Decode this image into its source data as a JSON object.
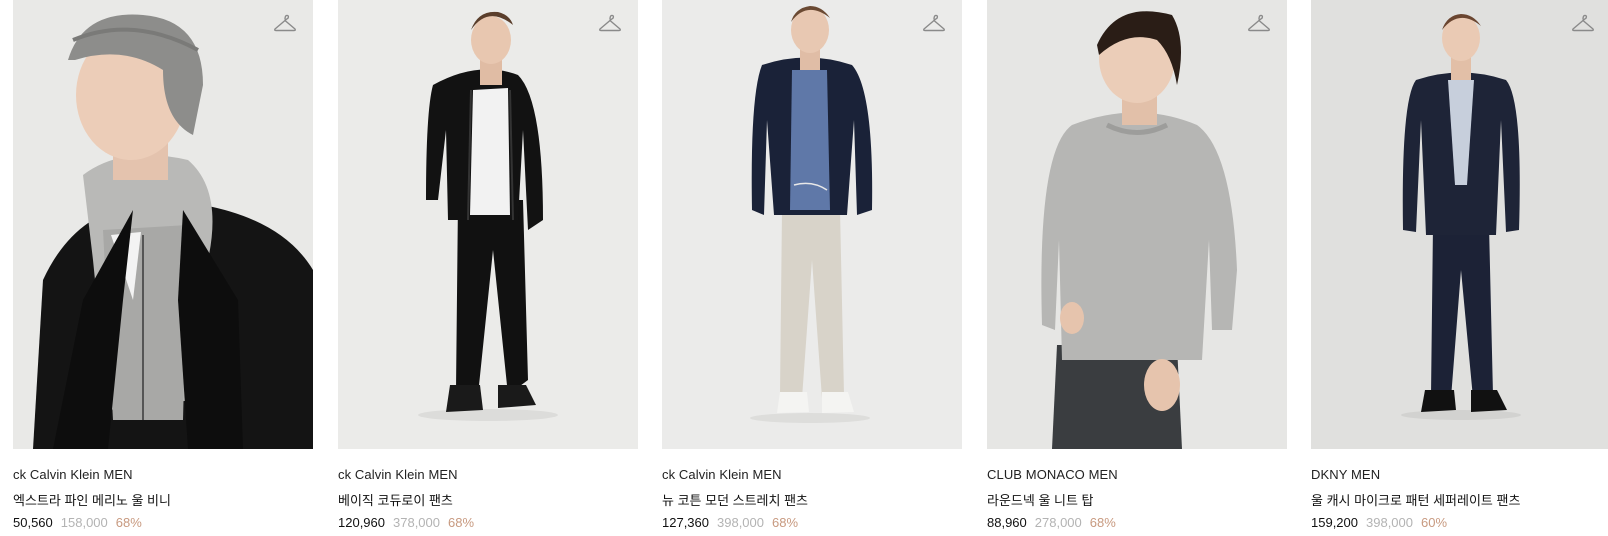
{
  "products": [
    {
      "brand": "ck Calvin Klein MEN",
      "name": "엑스트라 파인 메리노 울 비니",
      "sale_price": "50,560",
      "original_price": "158,000",
      "discount": "68%",
      "icon": "hanger-icon"
    },
    {
      "brand": "ck Calvin Klein MEN",
      "name": "베이직 코듀로이 팬츠",
      "sale_price": "120,960",
      "original_price": "378,000",
      "discount": "68%",
      "icon": "hanger-icon"
    },
    {
      "brand": "ck Calvin Klein MEN",
      "name": "뉴 코튼 모던 스트레치 팬츠",
      "sale_price": "127,360",
      "original_price": "398,000",
      "discount": "68%",
      "icon": "hanger-icon"
    },
    {
      "brand": "CLUB MONACO MEN",
      "name": "라운드넥 울 니트 탑",
      "sale_price": "88,960",
      "original_price": "278,000",
      "discount": "68%",
      "icon": "hanger-icon"
    },
    {
      "brand": "DKNY MEN",
      "name": "울 캐시 마이크로 패턴 세퍼레이트 팬츠",
      "sale_price": "159,200",
      "original_price": "398,000",
      "discount": "60%",
      "icon": "hanger-icon"
    }
  ],
  "colors": {
    "sale_price": "#111111",
    "original_price": "#b3b3b3",
    "discount": "#c89a80",
    "photo_background": "#ececea"
  }
}
